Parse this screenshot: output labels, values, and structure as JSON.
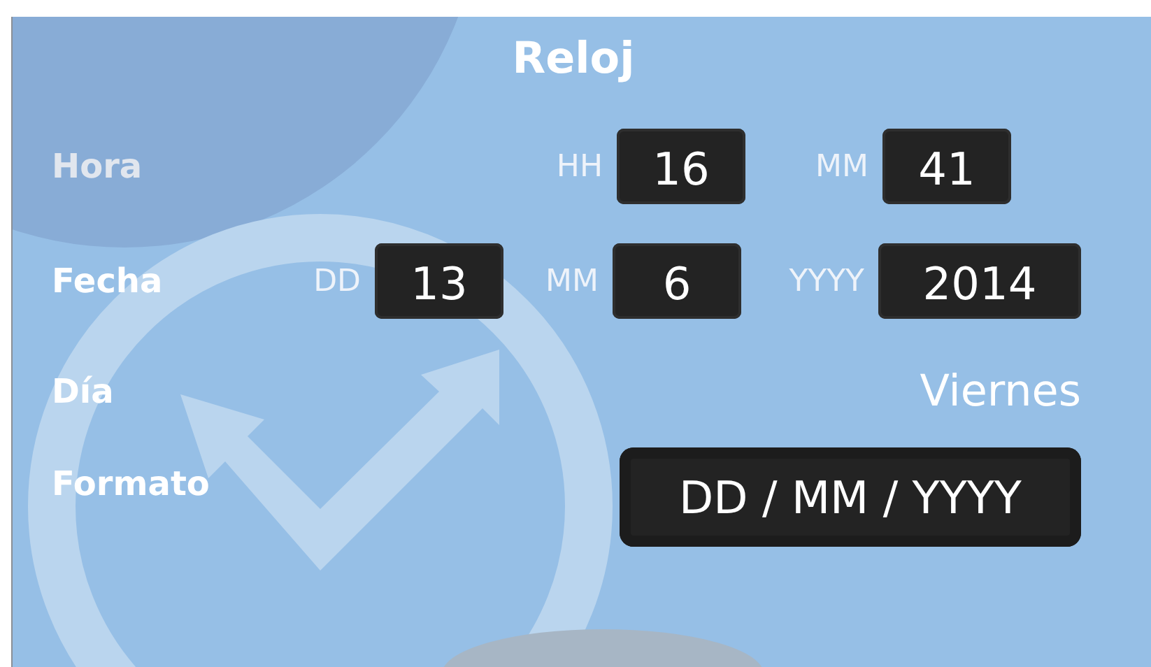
{
  "title": "Reloj",
  "rows": [
    {
      "kind": "time",
      "label": "Hora",
      "fields": [
        {
          "label": "HH",
          "value": "16"
        },
        {
          "label": "MM",
          "value": "41"
        }
      ]
    },
    {
      "kind": "date",
      "label": "Fecha",
      "fields": [
        {
          "label": "DD",
          "value": "13"
        },
        {
          "label": "MM",
          "value": "6"
        },
        {
          "label": "YYYY",
          "value": "2014"
        }
      ]
    },
    {
      "kind": "text",
      "label": "Día",
      "value": "Viernes"
    },
    {
      "kind": "button",
      "label": "Formato",
      "value": "DD / MM / YYYY"
    }
  ]
}
